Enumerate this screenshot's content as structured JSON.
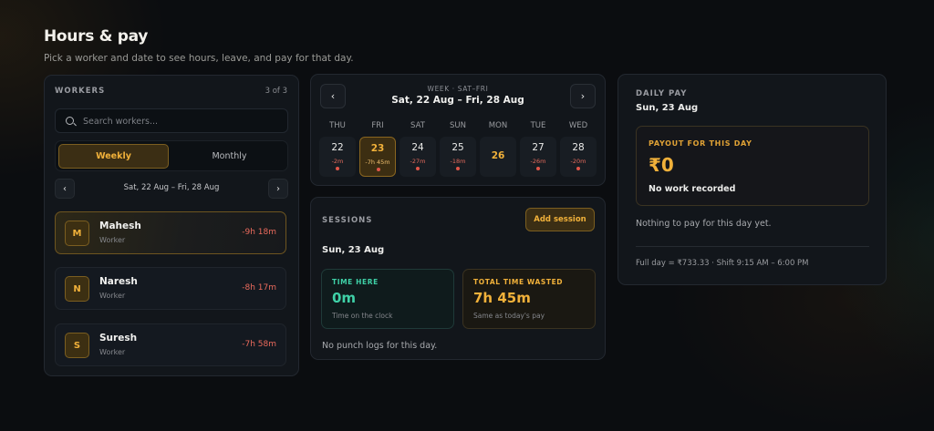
{
  "header": {
    "title": "Hours & pay",
    "subtitle": "Pick a worker and date to see hours, leave, and pay for that day."
  },
  "workers": {
    "heading": "WORKERS",
    "count": "3 of 3",
    "search_placeholder": "Search workers...",
    "tabs": {
      "weekly": "Weekly",
      "monthly": "Monthly",
      "selected": "Weekly"
    },
    "range_prev": "‹",
    "range_next": "›",
    "range_label": "Sat, 22 Aug – Fri, 28 Aug",
    "list": [
      {
        "initial": "M",
        "name": "Mahesh",
        "role": "Worker",
        "delta": "-9h 18m",
        "selected": true
      },
      {
        "initial": "N",
        "name": "Naresh",
        "role": "Worker",
        "delta": "-8h 17m",
        "selected": false
      },
      {
        "initial": "S",
        "name": "Suresh",
        "role": "Worker",
        "delta": "-7h 58m",
        "selected": false
      }
    ]
  },
  "week": {
    "kicker": "WEEK · SAT–FRI",
    "range": "Sat, 22 Aug – Fri, 28 Aug",
    "prev": "‹",
    "next": "›",
    "days": [
      {
        "dow": "THU",
        "num": "22",
        "sub": "-2m",
        "dot": true,
        "state": "normal"
      },
      {
        "dow": "FRI",
        "num": "23",
        "sub": "-7h 45m",
        "dot": true,
        "state": "selected"
      },
      {
        "dow": "SAT",
        "num": "24",
        "sub": "-27m",
        "dot": true,
        "state": "normal"
      },
      {
        "dow": "SUN",
        "num": "25",
        "sub": "-18m",
        "dot": true,
        "state": "normal"
      },
      {
        "dow": "MON",
        "num": "26",
        "sub": "",
        "dot": false,
        "state": "today"
      },
      {
        "dow": "TUE",
        "num": "27",
        "sub": "-26m",
        "dot": true,
        "state": "normal"
      },
      {
        "dow": "WED",
        "num": "28",
        "sub": "-20m",
        "dot": true,
        "state": "normal"
      }
    ]
  },
  "sessions": {
    "heading": "SESSIONS",
    "add_label": "Add session",
    "date": "Sun, 23 Aug",
    "time_here": {
      "label": "TIME HERE",
      "value": "0m",
      "note": "Time on the clock"
    },
    "time_wasted": {
      "label": "TOTAL TIME WASTED",
      "value": "7h 45m",
      "note": "Same as today's pay"
    },
    "empty_note": "No punch logs for this day."
  },
  "daily_pay": {
    "heading": "DAILY PAY",
    "date": "Sun, 23 Aug",
    "payout_label": "PAYOUT FOR THIS DAY",
    "payout_value": "₹0",
    "payout_note": "No work recorded",
    "nothing_note": "Nothing to pay for this day yet.",
    "full_day": "Full day = ₹733.33 · Shift 9:15 AM – 6:00 PM"
  },
  "colors": {
    "accent": "#f1b13a",
    "negative": "#ea6a5c",
    "positive": "#3fd1a7",
    "background": "#0b0d10",
    "panel": "#12161b"
  },
  "icons": {
    "search": "search-icon",
    "prev": "chevron-left-icon",
    "next": "chevron-right-icon"
  }
}
